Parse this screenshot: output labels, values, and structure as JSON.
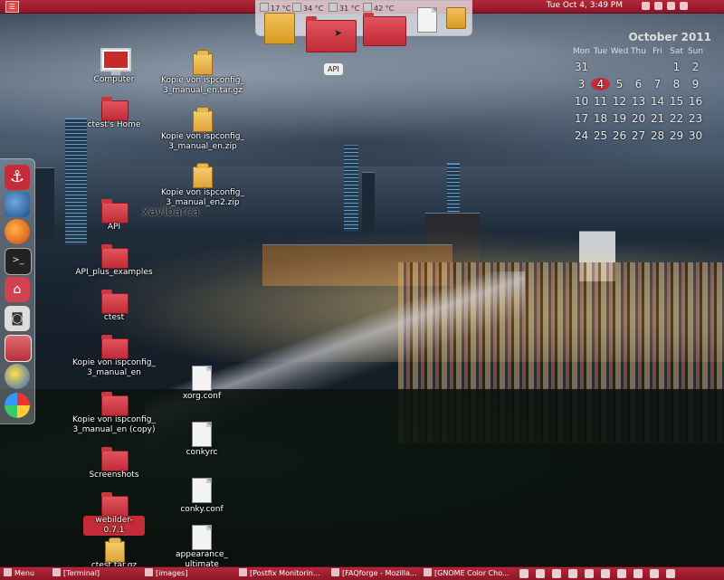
{
  "top_panel": {
    "menu_icon": "ubuntu-menu-icon",
    "clock": "Tue Oct  4,  3:49 PM",
    "temps": [
      "17 °C",
      "34 °C",
      "31 °C",
      "42 °C"
    ]
  },
  "dock_tooltip": "API",
  "calendar": {
    "title": "October 2011",
    "weekdays": [
      "Mon",
      "Tue",
      "Wed",
      "Thu",
      "Fri",
      "Sat",
      "Sun"
    ],
    "weeks": [
      [
        "",
        "",
        "",
        "",
        "",
        "",
        "31"
      ],
      [
        "",
        "",
        "",
        "",
        "",
        "1",
        "2"
      ]
    ],
    "rows": [
      [
        "31",
        "",
        "",
        "",
        "",
        "1",
        "2"
      ],
      [
        "3",
        "4",
        "5",
        "6",
        "7",
        "8",
        "9"
      ],
      [
        "10",
        "11",
        "12",
        "13",
        "14",
        "15",
        "16"
      ],
      [
        "17",
        "18",
        "19",
        "20",
        "21",
        "22",
        "23"
      ],
      [
        "24",
        "25",
        "26",
        "27",
        "28",
        "29",
        "30"
      ]
    ],
    "today": "4"
  },
  "desktop_icons": [
    {
      "label": "Computer"
    },
    {
      "label": "ctest's Home"
    },
    {
      "label": "Kopie von ispconfig_\n3_manual_en.tar.gz"
    },
    {
      "label": "Kopie von ispconfig_\n3_manual_en.zip"
    },
    {
      "label": "Kopie von ispconfig_\n3_manual_en2.zip"
    },
    {
      "label": "API"
    },
    {
      "label": "API_plus_examples"
    },
    {
      "label": "ctest"
    },
    {
      "label": "Kopie von ispconfig_\n3_manual_en"
    },
    {
      "label": "Kopie von ispconfig_\n3_manual_en (copy)"
    },
    {
      "label": "Screenshots"
    },
    {
      "label": "webilder-0.7.1"
    },
    {
      "label": "ctest.tar.gz"
    },
    {
      "label": "xorg.conf"
    },
    {
      "label": "conkyrc"
    },
    {
      "label": "conky.conf"
    },
    {
      "label": "appearance_\nultimate"
    }
  ],
  "overlay_text": "xavibarca",
  "taskbar": {
    "menu_label": "Menu",
    "tasks": [
      "[Terminal]",
      "[images]",
      "[Postfix Monitorin...",
      "[FAQforge - Mozilla...",
      "[GNOME Color Cho..."
    ]
  }
}
